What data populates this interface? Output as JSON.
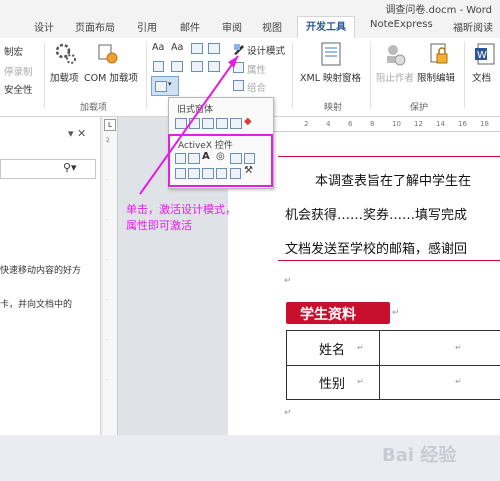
{
  "window": {
    "title": "调查问卷.docm - Word"
  },
  "tabs": [
    {
      "label": "设计"
    },
    {
      "label": "页面布局"
    },
    {
      "label": "引用"
    },
    {
      "label": "邮件"
    },
    {
      "label": "审阅"
    },
    {
      "label": "视图"
    },
    {
      "label": "开发工具",
      "active": true
    },
    {
      "label": "NoteExpress"
    },
    {
      "label": "福昕阅读"
    }
  ],
  "ribbon": {
    "code": {
      "macro_label": "制宏",
      "record_label": "停录制",
      "security_label": "安全性"
    },
    "addins": {
      "group_label": "加载项",
      "btn1": "加载项",
      "btn2": "COM 加载项"
    },
    "controls": {
      "design_mode": "设计模式",
      "properties": "属性",
      "group": "组合",
      "legacy_tools_label": "旧式窗体",
      "activex_label": "ActiveX 控件"
    },
    "mapping": {
      "group_label": "映射",
      "btn": "XML 映射窗格"
    },
    "protect": {
      "group_label": "保护",
      "btn1": "阻止作者",
      "btn2": "限制编辑"
    },
    "templates": {
      "btn": "文档"
    }
  },
  "left_pane": {
    "close_glyph": "▾ ✕",
    "search_icon": "search-icon",
    "text1": "快速移动内容的好方",
    "text2": "卡，并向文档中的"
  },
  "ruler": {
    "ticks": [
      "2",
      "4",
      "6",
      "8",
      "10",
      "12",
      "14",
      "16",
      "18"
    ]
  },
  "annotation": {
    "text": "单击，激活设计模式，\n属性即可激活",
    "color": "#e51ee5"
  },
  "document": {
    "p1": "本调查表旨在了解中学生在",
    "p2": "机会获得……奖券……填写完成",
    "p3": "文档发送至学校的邮箱，感谢回",
    "section_title": "学生资料",
    "section_bg": "#c8102e",
    "table": [
      {
        "label": "姓名"
      },
      {
        "label": "性别"
      }
    ]
  },
  "watermark": {
    "text": "Bai 经验"
  }
}
